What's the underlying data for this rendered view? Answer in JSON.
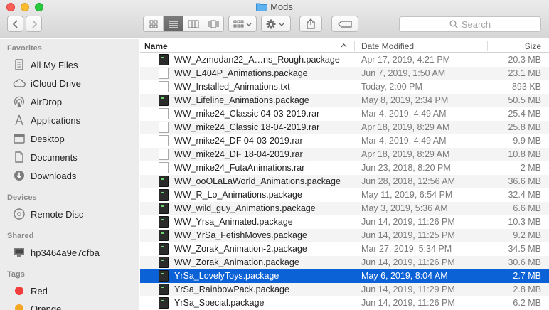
{
  "window": {
    "title": "Mods"
  },
  "search": {
    "placeholder": "Search"
  },
  "sidebar": {
    "favorites_label": "Favorites",
    "favorites": [
      {
        "label": "All My Files",
        "icon": "all-files-icon"
      },
      {
        "label": "iCloud Drive",
        "icon": "cloud-icon"
      },
      {
        "label": "AirDrop",
        "icon": "airdrop-icon"
      },
      {
        "label": "Applications",
        "icon": "applications-icon"
      },
      {
        "label": "Desktop",
        "icon": "desktop-icon"
      },
      {
        "label": "Documents",
        "icon": "documents-icon"
      },
      {
        "label": "Downloads",
        "icon": "downloads-icon"
      }
    ],
    "devices_label": "Devices",
    "devices": [
      {
        "label": "Remote Disc",
        "icon": "disc-icon"
      }
    ],
    "shared_label": "Shared",
    "shared": [
      {
        "label": "hp3464a9e7cfba",
        "icon": "computer-icon"
      }
    ],
    "tags_label": "Tags",
    "tags": [
      {
        "label": "Red",
        "color": "#f23d3d"
      },
      {
        "label": "Orange",
        "color": "#f5a623"
      }
    ]
  },
  "columns": {
    "name": "Name",
    "date": "Date Modified",
    "size": "Size"
  },
  "files": [
    {
      "name": "WW_Azmodan22_A…ns_Rough.package",
      "date": "Apr 17, 2019, 4:21 PM",
      "size": "20.3 MB",
      "kind": "package"
    },
    {
      "name": "WW_E404P_Animations.package",
      "date": "Jun 7, 2019, 1:50 AM",
      "size": "23.1 MB",
      "kind": "document"
    },
    {
      "name": "WW_Installed_Animations.txt",
      "date": "Today, 2:00 PM",
      "size": "893 KB",
      "kind": "text"
    },
    {
      "name": "WW_Lifeline_Animations.package",
      "date": "May 8, 2019, 2:34 PM",
      "size": "50.5 MB",
      "kind": "package"
    },
    {
      "name": "WW_mike24_Classic 04-03-2019.rar",
      "date": "Mar 4, 2019, 4:49 AM",
      "size": "25.4 MB",
      "kind": "document"
    },
    {
      "name": "WW_mike24_Classic 18-04-2019.rar",
      "date": "Apr 18, 2019, 8:29 AM",
      "size": "25.8 MB",
      "kind": "document"
    },
    {
      "name": "WW_mike24_DF 04-03-2019.rar",
      "date": "Mar 4, 2019, 4:49 AM",
      "size": "9.9 MB",
      "kind": "document"
    },
    {
      "name": "WW_mike24_DF 18-04-2019.rar",
      "date": "Apr 18, 2019, 8:29 AM",
      "size": "10.8 MB",
      "kind": "document"
    },
    {
      "name": "WW_mike24_FutaAnimations.rar",
      "date": "Jun 23, 2018, 8:20 PM",
      "size": "2 MB",
      "kind": "document"
    },
    {
      "name": "WW_ooOLaLaWorld_Animations.package",
      "date": "Jun 28, 2018, 12:56 AM",
      "size": "36.6 MB",
      "kind": "package"
    },
    {
      "name": "WW_R_Lo_Animations.package",
      "date": "May 11, 2019, 6:54 PM",
      "size": "32.4 MB",
      "kind": "package"
    },
    {
      "name": "WW_wild_guy_Animations.package",
      "date": "May 3, 2019, 5:36 AM",
      "size": "6.6 MB",
      "kind": "package"
    },
    {
      "name": "WW_Yrsa_Animated.package",
      "date": "Jun 14, 2019, 11:26 PM",
      "size": "10.3 MB",
      "kind": "package"
    },
    {
      "name": "WW_YrSa_FetishMoves.package",
      "date": "Jun 14, 2019, 11:25 PM",
      "size": "9.2 MB",
      "kind": "package"
    },
    {
      "name": "WW_Zorak_Animation-2.package",
      "date": "Mar 27, 2019, 5:34 PM",
      "size": "34.5 MB",
      "kind": "package"
    },
    {
      "name": "WW_Zorak_Animation.package",
      "date": "Jun 14, 2019, 11:26 PM",
      "size": "30.6 MB",
      "kind": "package"
    },
    {
      "name": "YrSa_LovelyToys.package",
      "date": "May 6, 2019, 8:04 AM",
      "size": "2.7 MB",
      "kind": "package",
      "selected": true
    },
    {
      "name": "YrSa_RainbowPack.package",
      "date": "Jun 14, 2019, 11:29 PM",
      "size": "2.8 MB",
      "kind": "package"
    },
    {
      "name": "YrSa_Special.package",
      "date": "Jun 14, 2019, 11:26 PM",
      "size": "6.2 MB",
      "kind": "package"
    }
  ]
}
